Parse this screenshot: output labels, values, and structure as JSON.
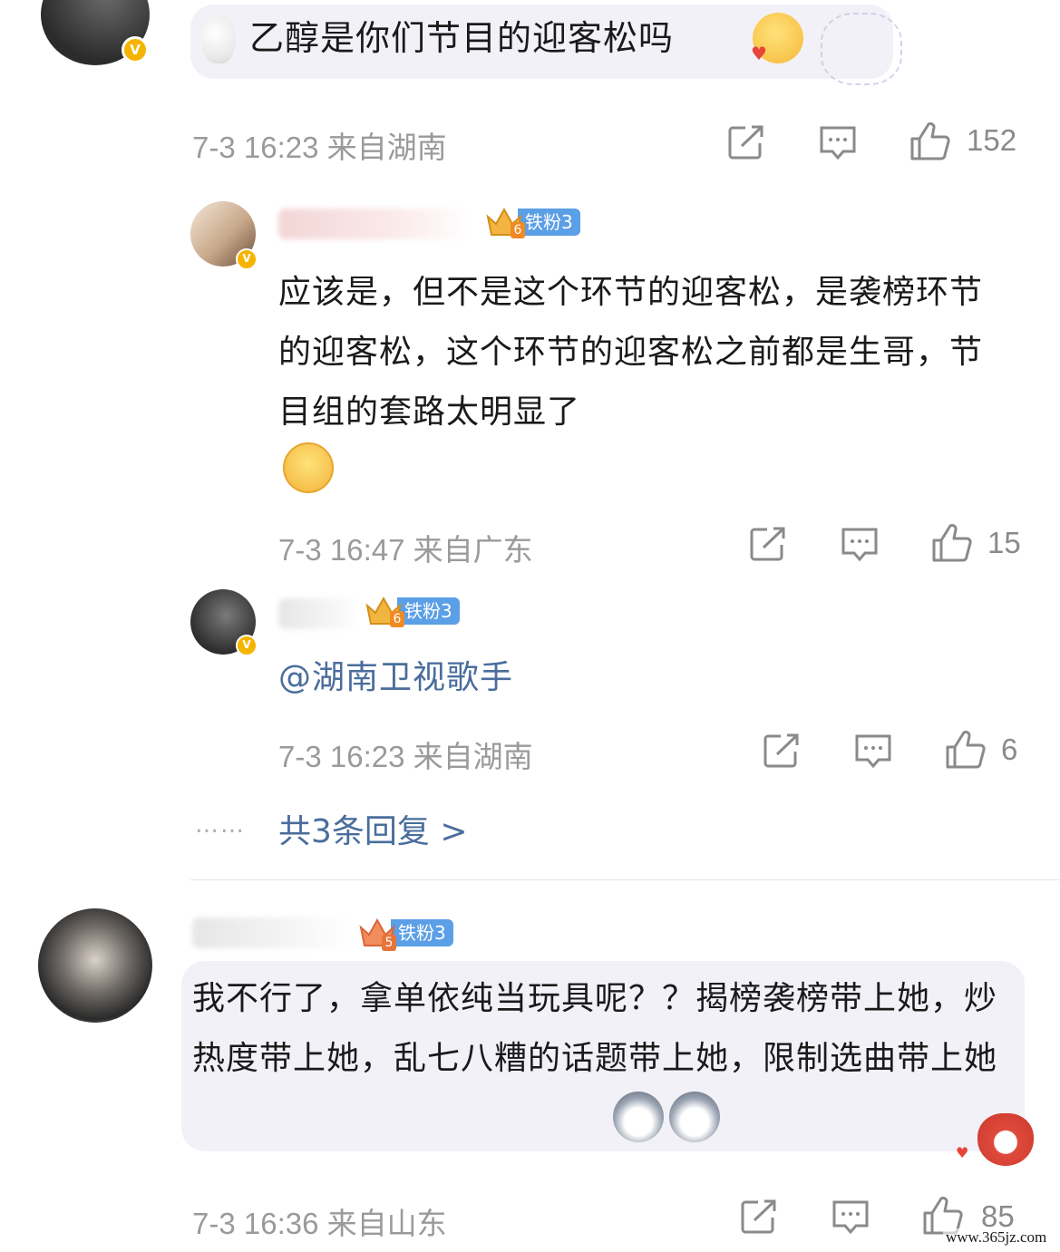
{
  "comments": [
    {
      "text": "乙醇是你们节目的迎客松吗",
      "time": "7-3 16:23",
      "location": "来自湖南",
      "likes": "152"
    },
    {
      "fan_badge": "铁粉3",
      "crown_level": "6",
      "text": "应该是，但不是这个环节的迎客松，是袭榜环节的迎客松，这个环节的迎客松之前都是生哥，节目组的套路太明显了",
      "time": "7-3 16:47",
      "location": "来自广东",
      "likes": "15"
    },
    {
      "fan_badge": "铁粉3",
      "crown_level": "6",
      "mention": "@湖南卫视歌手",
      "time": "7-3 16:23",
      "location": "来自湖南",
      "likes": "6"
    },
    {
      "fan_badge": "铁粉3",
      "crown_level": "5",
      "text": "我不行了，拿单依纯当玩具呢？？揭榜袭榜带上她，炒热度带上她，乱七八糟的话题带上她，限制选曲带上她",
      "time": "7-3 16:36",
      "location": "来自山东",
      "likes": "85"
    }
  ],
  "more_replies": "共3条回复 >",
  "ellipsis": "……",
  "watermark": "www.365jz.com",
  "icons": {
    "share": "share-icon",
    "comment": "comment-icon",
    "like": "thumbs-up-icon",
    "verified": "verified-v-badge"
  },
  "colors": {
    "link": "#4a6d9c",
    "meta": "#9a9a9a",
    "bubble": "#f3f1f8",
    "fan_badge": "#5b9fe6",
    "verified": "#f5b400"
  }
}
